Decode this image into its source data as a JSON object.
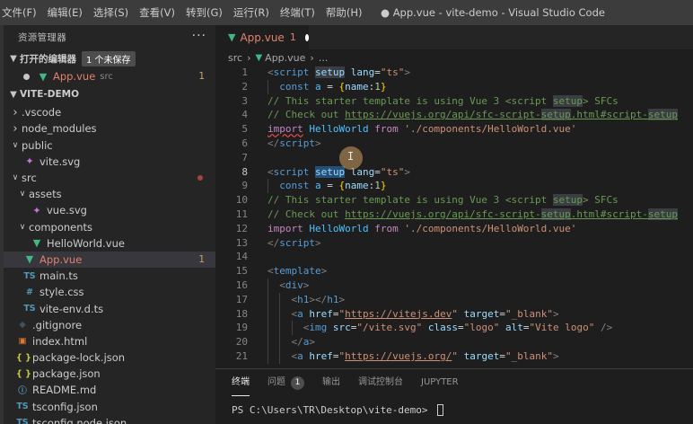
{
  "menu": [
    "文件(F)",
    "编辑(E)",
    "选择(S)",
    "查看(V)",
    "转到(G)",
    "运行(R)",
    "终端(T)",
    "帮助(H)"
  ],
  "window_title": "● App.vue - vite-demo - Visual Studio Code",
  "sidebar": {
    "title": "资源管理器",
    "more": "···",
    "open_editors": {
      "label": "打开的编辑器",
      "unsaved": "1 个未保存",
      "files": [
        {
          "name": "App.vue",
          "tag": "src",
          "problems": "1"
        }
      ]
    },
    "project": "VITE-DEMO",
    "tree": [
      {
        "name": ".vscode",
        "kind": "folder",
        "open": false,
        "depth": 1
      },
      {
        "name": "node_modules",
        "kind": "folder",
        "open": false,
        "depth": 1
      },
      {
        "name": "public",
        "kind": "folder",
        "open": true,
        "depth": 1
      },
      {
        "name": "vite.svg",
        "kind": "svg",
        "depth": 2
      },
      {
        "name": "src",
        "kind": "folder",
        "open": true,
        "depth": 1,
        "modified": true
      },
      {
        "name": "assets",
        "kind": "folder",
        "open": true,
        "depth": 2
      },
      {
        "name": "vue.svg",
        "kind": "svg",
        "depth": 3
      },
      {
        "name": "components",
        "kind": "folder",
        "open": true,
        "depth": 2
      },
      {
        "name": "HelloWorld.vue",
        "kind": "vue",
        "depth": 3
      },
      {
        "name": "App.vue",
        "kind": "vue",
        "depth": 2,
        "active": true,
        "problems": "1"
      },
      {
        "name": "main.ts",
        "kind": "ts",
        "depth": 2
      },
      {
        "name": "style.css",
        "kind": "css",
        "depth": 2
      },
      {
        "name": "vite-env.d.ts",
        "kind": "ts",
        "depth": 2
      },
      {
        "name": ".gitignore",
        "kind": "git",
        "depth": 1
      },
      {
        "name": "index.html",
        "kind": "html",
        "depth": 1
      },
      {
        "name": "package-lock.json",
        "kind": "json",
        "depth": 1
      },
      {
        "name": "package.json",
        "kind": "json",
        "depth": 1
      },
      {
        "name": "README.md",
        "kind": "md",
        "depth": 1
      },
      {
        "name": "tsconfig.json",
        "kind": "tsjson",
        "depth": 1
      },
      {
        "name": "tsconfig.node.json",
        "kind": "tsjson",
        "depth": 1
      }
    ]
  },
  "icons": {
    "folder_closed": "chevron-right-icon",
    "folder_open": "chevron-down-icon",
    "vue": "vue-file-icon",
    "ts": "typescript-file-icon",
    "css": "css-file-icon",
    "json": "json-file-icon",
    "svg": "svg-file-icon",
    "html": "html-file-icon",
    "git": "git-file-icon",
    "md": "info-file-icon"
  },
  "editor": {
    "tab": {
      "name": "App.vue",
      "problems": "1"
    },
    "breadcrumb": [
      "src",
      "App.vue",
      "..."
    ],
    "current_line": 8,
    "lines": [
      [
        {
          "t": "<",
          "c": "tag"
        },
        {
          "t": "script",
          "c": "name"
        },
        {
          "t": " "
        },
        {
          "t": "setup",
          "c": "attr",
          "h": "hl2"
        },
        {
          "t": " "
        },
        {
          "t": "lang",
          "c": "attr"
        },
        {
          "t": "=",
          "c": "def"
        },
        {
          "t": "\"ts\"",
          "c": "str"
        },
        {
          "t": ">",
          "c": "tag"
        }
      ],
      [
        {
          "t": "  "
        },
        {
          "t": "const",
          "c": "kw"
        },
        {
          "t": " "
        },
        {
          "t": "a",
          "c": "var"
        },
        {
          "t": " = ",
          "c": "def"
        },
        {
          "t": "{",
          "c": "brace"
        },
        {
          "t": "name",
          "c": "prop"
        },
        {
          "t": ":",
          "c": "def"
        },
        {
          "t": "1",
          "c": "num"
        },
        {
          "t": "}",
          "c": "brace"
        }
      ],
      [
        {
          "t": "// This starter template is using Vue 3 <script ",
          "c": "cm"
        },
        {
          "t": "setup",
          "c": "cm",
          "h": "hl2"
        },
        {
          "t": "> SFCs",
          "c": "cm"
        }
      ],
      [
        {
          "t": "// Check out ",
          "c": "cm"
        },
        {
          "t": "https://vuejs.org/api/sfc-script-",
          "c": "url"
        },
        {
          "t": "setup",
          "c": "url",
          "h": "hl2"
        },
        {
          "t": ".html#script-",
          "c": "url"
        },
        {
          "t": "setup",
          "c": "url",
          "h": "hl2"
        }
      ],
      [
        {
          "t": "import",
          "c": "imp",
          "s": true
        },
        {
          "t": " "
        },
        {
          "t": "HelloWorld",
          "c": "var"
        },
        {
          "t": " "
        },
        {
          "t": "from",
          "c": "imp"
        },
        {
          "t": " "
        },
        {
          "t": "'./components/HelloWorld.vue'",
          "c": "str"
        }
      ],
      [
        {
          "t": "</",
          "c": "tag"
        },
        {
          "t": "script",
          "c": "name"
        },
        {
          "t": ">",
          "c": "tag"
        }
      ],
      [],
      [
        {
          "t": "<",
          "c": "tag"
        },
        {
          "t": "script",
          "c": "name"
        },
        {
          "t": " "
        },
        {
          "t": "setup",
          "c": "attr",
          "h": "hl"
        },
        {
          "t": " "
        },
        {
          "t": "lang",
          "c": "attr"
        },
        {
          "t": "=",
          "c": "def"
        },
        {
          "t": "\"ts\"",
          "c": "str"
        },
        {
          "t": ">",
          "c": "tag"
        }
      ],
      [
        {
          "t": "  "
        },
        {
          "t": "const",
          "c": "kw"
        },
        {
          "t": " "
        },
        {
          "t": "a",
          "c": "var"
        },
        {
          "t": " = ",
          "c": "def"
        },
        {
          "t": "{",
          "c": "brace"
        },
        {
          "t": "name",
          "c": "prop"
        },
        {
          "t": ":",
          "c": "def"
        },
        {
          "t": "1",
          "c": "num"
        },
        {
          "t": "}",
          "c": "brace"
        }
      ],
      [
        {
          "t": "// This starter template is using Vue 3 <script ",
          "c": "cm"
        },
        {
          "t": "setup",
          "c": "cm",
          "h": "hl2"
        },
        {
          "t": "> SFCs",
          "c": "cm"
        }
      ],
      [
        {
          "t": "// Check out ",
          "c": "cm"
        },
        {
          "t": "https://vuejs.org/api/sfc-script-",
          "c": "url"
        },
        {
          "t": "setup",
          "c": "url",
          "h": "hl2"
        },
        {
          "t": ".html#script-",
          "c": "url"
        },
        {
          "t": "setup",
          "c": "url",
          "h": "hl2"
        }
      ],
      [
        {
          "t": "import",
          "c": "imp"
        },
        {
          "t": " "
        },
        {
          "t": "HelloWorld",
          "c": "var"
        },
        {
          "t": " "
        },
        {
          "t": "from",
          "c": "imp"
        },
        {
          "t": " "
        },
        {
          "t": "'./components/HelloWorld.vue'",
          "c": "str"
        }
      ],
      [
        {
          "t": "</",
          "c": "tag"
        },
        {
          "t": "script",
          "c": "name"
        },
        {
          "t": ">",
          "c": "tag"
        }
      ],
      [],
      [
        {
          "t": "<",
          "c": "tag"
        },
        {
          "t": "template",
          "c": "name"
        },
        {
          "t": ">",
          "c": "tag"
        }
      ],
      [
        {
          "t": "  "
        },
        {
          "t": "<",
          "c": "tag"
        },
        {
          "t": "div",
          "c": "name"
        },
        {
          "t": ">",
          "c": "tag"
        }
      ],
      [
        {
          "t": "    "
        },
        {
          "t": "<",
          "c": "tag"
        },
        {
          "t": "h1",
          "c": "name"
        },
        {
          "t": "></",
          "c": "tag"
        },
        {
          "t": "h1",
          "c": "name"
        },
        {
          "t": ">",
          "c": "tag"
        }
      ],
      [
        {
          "t": "    "
        },
        {
          "t": "<",
          "c": "tag"
        },
        {
          "t": "a",
          "c": "name"
        },
        {
          "t": " "
        },
        {
          "t": "href",
          "c": "attr"
        },
        {
          "t": "=",
          "c": "def"
        },
        {
          "t": "\"",
          "c": "str"
        },
        {
          "t": "https://vitejs.dev",
          "c": "str",
          "u": true
        },
        {
          "t": "\"",
          "c": "str"
        },
        {
          "t": " "
        },
        {
          "t": "target",
          "c": "attr"
        },
        {
          "t": "=",
          "c": "def"
        },
        {
          "t": "\"_blank\"",
          "c": "str"
        },
        {
          "t": ">",
          "c": "tag"
        }
      ],
      [
        {
          "t": "      "
        },
        {
          "t": "<",
          "c": "tag"
        },
        {
          "t": "img",
          "c": "name"
        },
        {
          "t": " "
        },
        {
          "t": "src",
          "c": "attr"
        },
        {
          "t": "=",
          "c": "def"
        },
        {
          "t": "\"/vite.svg\"",
          "c": "str"
        },
        {
          "t": " "
        },
        {
          "t": "class",
          "c": "attr"
        },
        {
          "t": "=",
          "c": "def"
        },
        {
          "t": "\"logo\"",
          "c": "str"
        },
        {
          "t": " "
        },
        {
          "t": "alt",
          "c": "attr"
        },
        {
          "t": "=",
          "c": "def"
        },
        {
          "t": "\"Vite logo\"",
          "c": "str"
        },
        {
          "t": " />",
          "c": "tag"
        }
      ],
      [
        {
          "t": "    "
        },
        {
          "t": "</",
          "c": "tag"
        },
        {
          "t": "a",
          "c": "name"
        },
        {
          "t": ">",
          "c": "tag"
        }
      ],
      [
        {
          "t": "    "
        },
        {
          "t": "<",
          "c": "tag"
        },
        {
          "t": "a",
          "c": "name"
        },
        {
          "t": " "
        },
        {
          "t": "href",
          "c": "attr"
        },
        {
          "t": "=",
          "c": "def"
        },
        {
          "t": "\"",
          "c": "str"
        },
        {
          "t": "https://vuejs.org/",
          "c": "str",
          "u": true
        },
        {
          "t": "\"",
          "c": "str"
        },
        {
          "t": " "
        },
        {
          "t": "target",
          "c": "attr"
        },
        {
          "t": "=",
          "c": "def"
        },
        {
          "t": "\"_blank\"",
          "c": "str"
        },
        {
          "t": ">",
          "c": "tag"
        }
      ]
    ]
  },
  "panel": {
    "tabs": [
      {
        "label": "终端",
        "active": true
      },
      {
        "label": "问题",
        "badge": "1"
      },
      {
        "label": "输出"
      },
      {
        "label": "调试控制台"
      },
      {
        "label": "JUPYTER"
      }
    ],
    "prompt": "PS C:\\Users\\TR\\Desktop\\vite-demo> "
  }
}
